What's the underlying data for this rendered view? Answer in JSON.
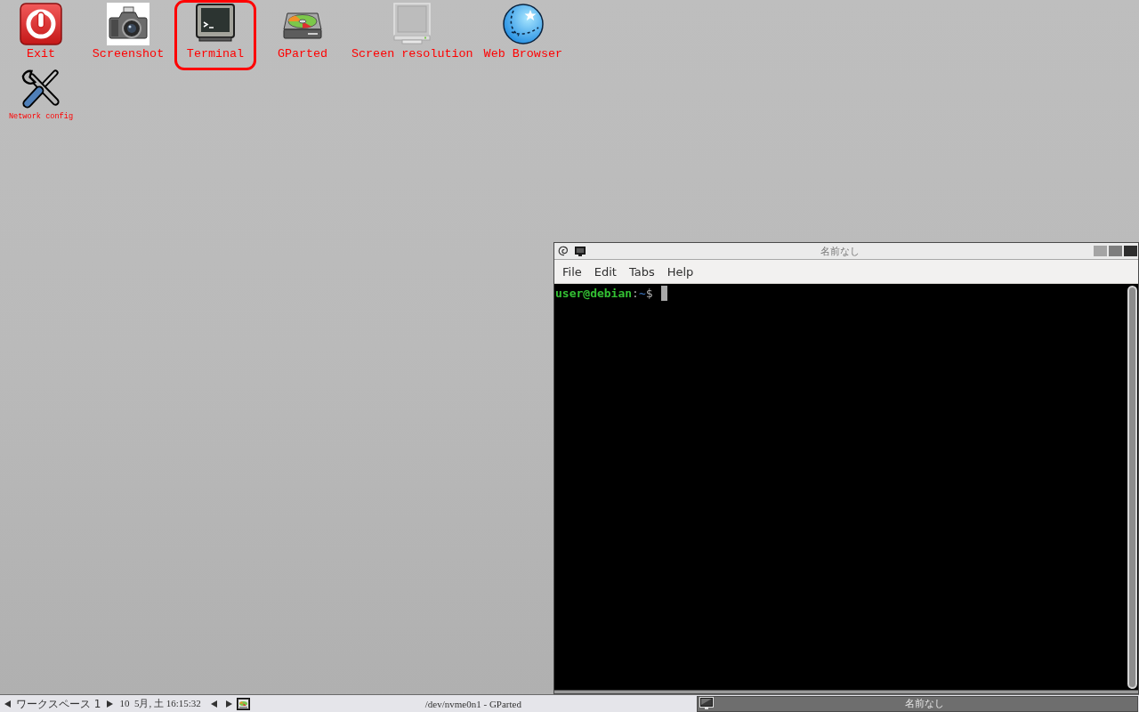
{
  "desktop": {
    "rows": [
      {
        "icons": [
          {
            "label": "Exit",
            "selected": false
          },
          {
            "label": "Screenshot",
            "selected": false
          },
          {
            "label": "Terminal",
            "selected": true
          },
          {
            "label": "GParted",
            "selected": false
          },
          {
            "label": "Screen resolution",
            "selected": false
          },
          {
            "label": "Web Browser",
            "selected": false
          }
        ]
      },
      {
        "icons": [
          {
            "label": "Network config",
            "selected": false
          }
        ]
      }
    ]
  },
  "terminal_window": {
    "title": "名前なし",
    "menu": [
      "File",
      "Edit",
      "Tabs",
      "Help"
    ],
    "prompt": {
      "user_host": "user@debian",
      "separator": ":",
      "path": "~",
      "symbol": "$"
    }
  },
  "taskbar": {
    "workspace": "ワークスペース 1",
    "clock": "10  5月, 土 16:15:32",
    "tasks": [
      {
        "title": "/dev/nvme0n1 - GParted",
        "selected": false
      },
      {
        "title": "名前なし",
        "selected": true
      }
    ]
  }
}
